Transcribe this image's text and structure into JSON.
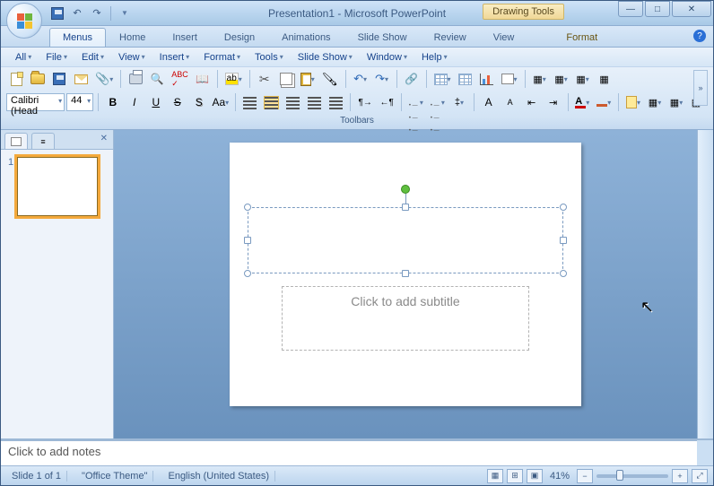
{
  "title": "Presentation1 - Microsoft PowerPoint",
  "contextual_tools_label": "Drawing Tools",
  "qat": {
    "save": "💾",
    "undo": "↶",
    "redo": "↷"
  },
  "tabs": [
    "Menus",
    "Home",
    "Insert",
    "Design",
    "Animations",
    "Slide Show",
    "Review",
    "View"
  ],
  "context_tab": "Format",
  "active_tab_index": 0,
  "classic_menus": [
    "All",
    "File",
    "Edit",
    "View",
    "Insert",
    "Format",
    "Tools",
    "Slide Show",
    "Window",
    "Help"
  ],
  "font": {
    "name": "Calibri (Head",
    "size": "44"
  },
  "toolbar_group_label": "Toolbars",
  "slide": {
    "subtitle_placeholder": "Click to add subtitle"
  },
  "notes_placeholder": "Click to add notes",
  "status": {
    "slide": "Slide 1 of 1",
    "theme": "\"Office Theme\"",
    "language": "English (United States)",
    "zoom": "41%"
  },
  "thumbnails": [
    {
      "num": "1"
    }
  ],
  "icons": {
    "bold": "B",
    "italic": "I",
    "underline": "U",
    "strike": "S",
    "shadow": "S",
    "grow": "Aa",
    "caseA": "A",
    "increaseInd": "≡",
    "decreaseInd": "≡",
    "cut": "✂",
    "brush": "🖌",
    "undo": "↶",
    "redo": "↷",
    "minus": "−",
    "plus": "+",
    "fit": "⤢"
  }
}
